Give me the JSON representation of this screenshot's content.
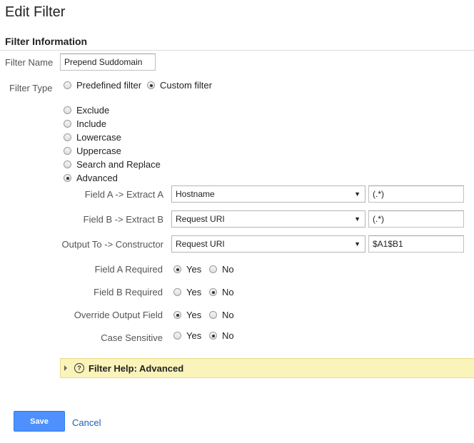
{
  "page": {
    "title": "Edit Filter"
  },
  "section": {
    "title": "Filter Information"
  },
  "filter_name": {
    "label": "Filter Name",
    "value": "Prepend Suddomain"
  },
  "filter_type": {
    "label": "Filter Type",
    "options": [
      {
        "label": "Predefined filter",
        "checked": false
      },
      {
        "label": "Custom filter",
        "checked": true
      }
    ]
  },
  "custom_options": [
    {
      "label": "Exclude",
      "checked": false
    },
    {
      "label": "Include",
      "checked": false
    },
    {
      "label": "Lowercase",
      "checked": false
    },
    {
      "label": "Uppercase",
      "checked": false
    },
    {
      "label": "Search and Replace",
      "checked": false
    },
    {
      "label": "Advanced",
      "checked": true
    }
  ],
  "advanced": {
    "field_a": {
      "label": "Field A -> Extract A",
      "select": "Hostname",
      "value": "(.*)"
    },
    "field_b": {
      "label": "Field B -> Extract B",
      "select": "Request URI",
      "value": "(.*)"
    },
    "output": {
      "label": "Output To -> Constructor",
      "select": "Request URI",
      "value": "$A1$B1"
    },
    "field_a_required": {
      "label": "Field A Required",
      "yes": "Yes",
      "no": "No",
      "selected": "yes"
    },
    "field_b_required": {
      "label": "Field B Required",
      "yes": "Yes",
      "no": "No",
      "selected": "no"
    },
    "override_output": {
      "label": "Override Output Field",
      "yes": "Yes",
      "no": "No",
      "selected": "yes"
    },
    "case_sensitive": {
      "label": "Case Sensitive",
      "yes": "Yes",
      "no": "No",
      "selected": "no"
    }
  },
  "help": {
    "label": "Filter Help: Advanced",
    "icon": "help-circle-icon"
  },
  "actions": {
    "save": "Save",
    "cancel": "Cancel"
  },
  "colors": {
    "save_button": "#4d90fe",
    "help_bar": "#faf3ba",
    "link": "#1a5fb4"
  }
}
